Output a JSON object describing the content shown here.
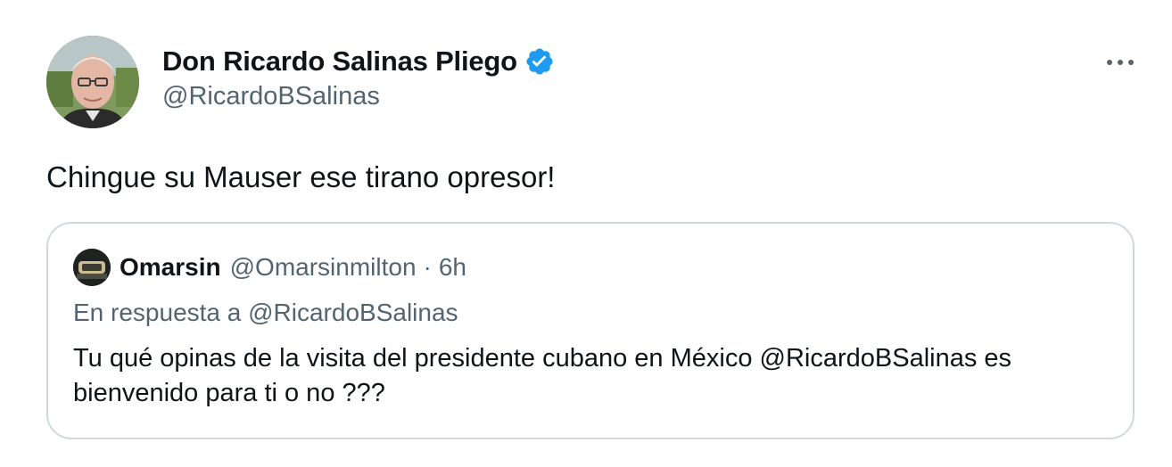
{
  "tweet": {
    "author_name": "Don Ricardo Salinas Pliego",
    "author_handle": "@RicardoBSalinas",
    "verified": true,
    "more_icon": "more-horizontal-icon",
    "text": "Chingue su Mauser ese tirano opresor!"
  },
  "quoted_tweet": {
    "author_name": "Omarsin",
    "author_handle": "@Omarsinmilton",
    "separator": "·",
    "time": "6h",
    "reply_context": "En respuesta a @RicardoBSalinas",
    "text": "Tu qué opinas de la visita del presidente cubano en México @RicardoBSalinas es bienvenido para ti o no ???"
  },
  "colors": {
    "text_primary": "#0f1419",
    "text_secondary": "#536471",
    "verified_blue": "#1d9bf0",
    "border": "#cfd9de"
  }
}
